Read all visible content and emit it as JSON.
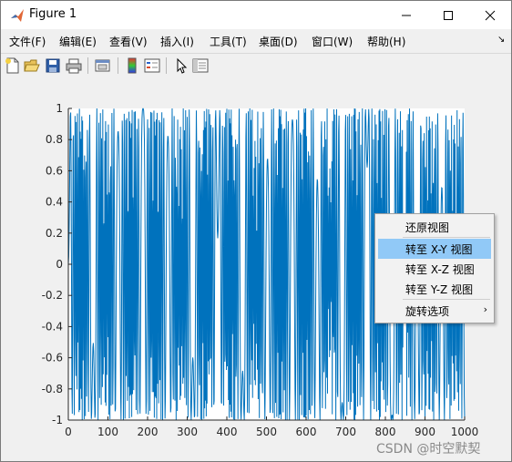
{
  "window": {
    "title": "Figure 1"
  },
  "menubar": {
    "items": [
      "文件(F)",
      "编辑(E)",
      "查看(V)",
      "插入(I)",
      "工具(T)",
      "桌面(D)",
      "窗口(W)",
      "帮助(H)"
    ]
  },
  "toolbar": {
    "icons": [
      "new-figure-icon",
      "open-file-icon",
      "save-icon",
      "print-icon",
      "dock-figure-icon",
      "insert-colorbar-icon",
      "insert-legend-icon",
      "edit-plot-icon",
      "property-inspector-icon"
    ]
  },
  "context_menu": {
    "items": [
      "还原视图",
      "转至 X-Y 视图",
      "转至 X-Z 视图",
      "转至 Y-Z 视图",
      "旋转选项"
    ],
    "highlighted": "转至 X-Y 视图"
  },
  "watermark": "CSDN @时空默契",
  "colors": {
    "line": "#0072BD",
    "highlight": "#91c9f7"
  },
  "chart_data": {
    "type": "line",
    "series": [
      {
        "function": "sin(0.05 * x^2)",
        "x_start": 0,
        "x_end": 1000
      }
    ],
    "xlim": [
      0,
      1000
    ],
    "ylim": [
      -1,
      1
    ],
    "xticks": [
      "0",
      "100",
      "200",
      "300",
      "400",
      "500",
      "600",
      "700",
      "800",
      "900",
      "1000"
    ],
    "yticks": [
      "1",
      "0.8",
      "0.6",
      "0.4",
      "0.2",
      "0",
      "-0.2",
      "-0.4",
      "-0.6",
      "-0.8",
      "-1"
    ],
    "grid": false
  }
}
